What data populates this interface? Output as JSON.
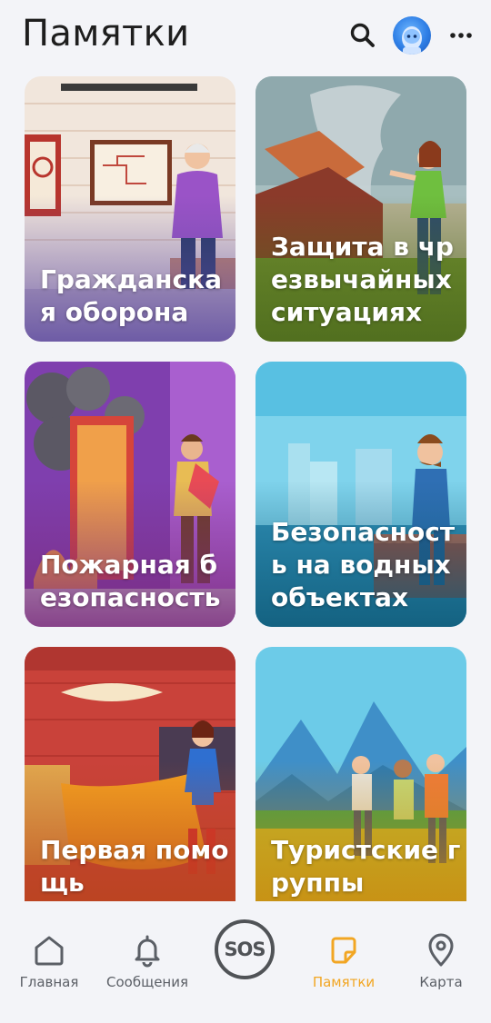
{
  "header": {
    "title": "Памятки",
    "search_icon": "search-icon",
    "avatar_icon": "avatar",
    "more_icon": "more-vertical-icon"
  },
  "cards": [
    {
      "label": "Гражданская оборона",
      "image": "elderly man pointing at evacuation plan",
      "colors": {
        "shade": "#5d4aa0"
      }
    },
    {
      "label": "Защита в чрезвычайных ситуациях",
      "image": "tornado destroying house, woman pointing",
      "colors": {
        "shade": "#4c6a1c"
      }
    },
    {
      "label": "Пожарная безопасность",
      "image": "man carrying woman out of burning house",
      "colors": {
        "shade": "#7a2a7c"
      }
    },
    {
      "label": "Безопасность на водных объектах",
      "image": "man on pier by water with city skyline",
      "colors": {
        "shade": "#0f5a78"
      }
    },
    {
      "label": "Первая помощь",
      "image": "superhero woman in red room",
      "colors": {
        "shade": "#b8451c"
      }
    },
    {
      "label": "Туристские группы",
      "image": "hikers with backpacks in mountains",
      "colors": {
        "shade": "#c98a10"
      }
    }
  ],
  "bottom_nav": {
    "items": [
      {
        "label": "Главная",
        "icon": "home-icon",
        "active": false
      },
      {
        "label": "Сообщения",
        "icon": "bell-icon",
        "active": false
      },
      {
        "label": "SOS",
        "icon": "sos-button",
        "active": false
      },
      {
        "label": "Памятки",
        "icon": "memo-note-icon",
        "active": true
      },
      {
        "label": "Карта",
        "icon": "map-pin-icon",
        "active": false
      }
    ],
    "colors": {
      "active": "#f2a623",
      "inactive": "#5b5f66"
    }
  }
}
